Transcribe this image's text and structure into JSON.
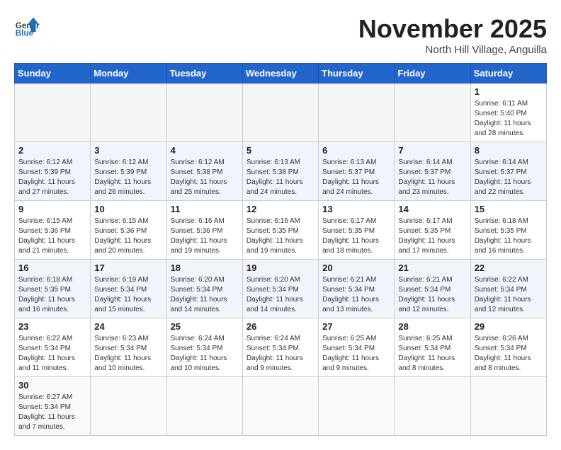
{
  "header": {
    "logo_general": "General",
    "logo_blue": "Blue",
    "month": "November 2025",
    "location": "North Hill Village, Anguilla"
  },
  "weekdays": [
    "Sunday",
    "Monday",
    "Tuesday",
    "Wednesday",
    "Thursday",
    "Friday",
    "Saturday"
  ],
  "weeks": [
    [
      {
        "day": "",
        "empty": true
      },
      {
        "day": "",
        "empty": true
      },
      {
        "day": "",
        "empty": true
      },
      {
        "day": "",
        "empty": true
      },
      {
        "day": "",
        "empty": true
      },
      {
        "day": "",
        "empty": true
      },
      {
        "day": "1",
        "sunrise": "6:11 AM",
        "sunset": "5:40 PM",
        "daylight": "11 hours and 28 minutes."
      }
    ],
    [
      {
        "day": "2",
        "sunrise": "6:12 AM",
        "sunset": "5:39 PM",
        "daylight": "11 hours and 27 minutes."
      },
      {
        "day": "3",
        "sunrise": "6:12 AM",
        "sunset": "5:39 PM",
        "daylight": "11 hours and 26 minutes."
      },
      {
        "day": "4",
        "sunrise": "6:12 AM",
        "sunset": "5:38 PM",
        "daylight": "11 hours and 25 minutes."
      },
      {
        "day": "5",
        "sunrise": "6:13 AM",
        "sunset": "5:38 PM",
        "daylight": "11 hours and 24 minutes."
      },
      {
        "day": "6",
        "sunrise": "6:13 AM",
        "sunset": "5:37 PM",
        "daylight": "11 hours and 24 minutes."
      },
      {
        "day": "7",
        "sunrise": "6:14 AM",
        "sunset": "5:37 PM",
        "daylight": "11 hours and 23 minutes."
      },
      {
        "day": "8",
        "sunrise": "6:14 AM",
        "sunset": "5:37 PM",
        "daylight": "11 hours and 22 minutes."
      }
    ],
    [
      {
        "day": "9",
        "sunrise": "6:15 AM",
        "sunset": "5:36 PM",
        "daylight": "11 hours and 21 minutes."
      },
      {
        "day": "10",
        "sunrise": "6:15 AM",
        "sunset": "5:36 PM",
        "daylight": "11 hours and 20 minutes."
      },
      {
        "day": "11",
        "sunrise": "6:16 AM",
        "sunset": "5:36 PM",
        "daylight": "11 hours and 19 minutes."
      },
      {
        "day": "12",
        "sunrise": "6:16 AM",
        "sunset": "5:35 PM",
        "daylight": "11 hours and 19 minutes."
      },
      {
        "day": "13",
        "sunrise": "6:17 AM",
        "sunset": "5:35 PM",
        "daylight": "11 hours and 18 minutes."
      },
      {
        "day": "14",
        "sunrise": "6:17 AM",
        "sunset": "5:35 PM",
        "daylight": "11 hours and 17 minutes."
      },
      {
        "day": "15",
        "sunrise": "6:18 AM",
        "sunset": "5:35 PM",
        "daylight": "11 hours and 16 minutes."
      }
    ],
    [
      {
        "day": "16",
        "sunrise": "6:18 AM",
        "sunset": "5:35 PM",
        "daylight": "11 hours and 16 minutes."
      },
      {
        "day": "17",
        "sunrise": "6:19 AM",
        "sunset": "5:34 PM",
        "daylight": "11 hours and 15 minutes."
      },
      {
        "day": "18",
        "sunrise": "6:20 AM",
        "sunset": "5:34 PM",
        "daylight": "11 hours and 14 minutes."
      },
      {
        "day": "19",
        "sunrise": "6:20 AM",
        "sunset": "5:34 PM",
        "daylight": "11 hours and 14 minutes."
      },
      {
        "day": "20",
        "sunrise": "6:21 AM",
        "sunset": "5:34 PM",
        "daylight": "11 hours and 13 minutes."
      },
      {
        "day": "21",
        "sunrise": "6:21 AM",
        "sunset": "5:34 PM",
        "daylight": "11 hours and 12 minutes."
      },
      {
        "day": "22",
        "sunrise": "6:22 AM",
        "sunset": "5:34 PM",
        "daylight": "11 hours and 12 minutes."
      }
    ],
    [
      {
        "day": "23",
        "sunrise": "6:22 AM",
        "sunset": "5:34 PM",
        "daylight": "11 hours and 11 minutes."
      },
      {
        "day": "24",
        "sunrise": "6:23 AM",
        "sunset": "5:34 PM",
        "daylight": "11 hours and 10 minutes."
      },
      {
        "day": "25",
        "sunrise": "6:24 AM",
        "sunset": "5:34 PM",
        "daylight": "11 hours and 10 minutes."
      },
      {
        "day": "26",
        "sunrise": "6:24 AM",
        "sunset": "5:34 PM",
        "daylight": "11 hours and 9 minutes."
      },
      {
        "day": "27",
        "sunrise": "6:25 AM",
        "sunset": "5:34 PM",
        "daylight": "11 hours and 9 minutes."
      },
      {
        "day": "28",
        "sunrise": "6:25 AM",
        "sunset": "5:34 PM",
        "daylight": "11 hours and 8 minutes."
      },
      {
        "day": "29",
        "sunrise": "6:26 AM",
        "sunset": "5:34 PM",
        "daylight": "11 hours and 8 minutes."
      }
    ],
    [
      {
        "day": "30",
        "sunrise": "6:27 AM",
        "sunset": "5:34 PM",
        "daylight": "11 hours and 7 minutes."
      },
      {
        "day": "",
        "empty": true
      },
      {
        "day": "",
        "empty": true
      },
      {
        "day": "",
        "empty": true
      },
      {
        "day": "",
        "empty": true
      },
      {
        "day": "",
        "empty": true
      },
      {
        "day": "",
        "empty": true
      }
    ]
  ]
}
